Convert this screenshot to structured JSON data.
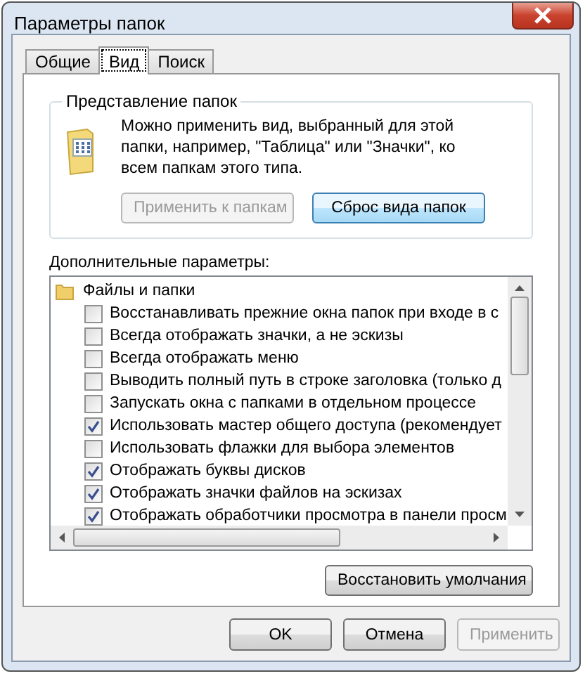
{
  "window": {
    "title": "Параметры папок"
  },
  "tabs": [
    {
      "label": "Общие",
      "selected": false
    },
    {
      "label": "Вид",
      "selected": true
    },
    {
      "label": "Поиск",
      "selected": false
    }
  ],
  "folder_views": {
    "title": "Представление папок",
    "description": "Можно применить вид, выбранный для этой папки, например, \"Таблица\" или \"Значки\", ко всем папкам этого типа.",
    "buttons": [
      {
        "label": "Применить к папкам",
        "disabled": true
      },
      {
        "label": "Сброс вида папок",
        "disabled": false
      }
    ]
  },
  "advanced": {
    "label": "Дополнительные параметры:",
    "tree": [
      {
        "kind": "folder",
        "label": "Файлы и папки",
        "children": [
          {
            "kind": "checkbox",
            "label": "Восстанавливать прежние окна папок при входе в с",
            "checked": false
          },
          {
            "kind": "checkbox",
            "label": "Всегда отображать значки, а не эскизы",
            "checked": false
          },
          {
            "kind": "checkbox",
            "label": "Всегда отображать меню",
            "checked": false
          },
          {
            "kind": "checkbox",
            "label": "Выводить полный путь в строке заголовка (только д",
            "checked": false
          },
          {
            "kind": "checkbox",
            "label": "Запускать окна с папками в отдельном процессе",
            "checked": false
          },
          {
            "kind": "checkbox",
            "label": "Использовать мастер общего доступа (рекомендует",
            "checked": true
          },
          {
            "kind": "checkbox",
            "label": "Использовать флажки для выбора элементов",
            "checked": false
          },
          {
            "kind": "checkbox",
            "label": "Отображать буквы дисков",
            "checked": true
          },
          {
            "kind": "checkbox",
            "label": "Отображать значки файлов на эскизах",
            "checked": true
          },
          {
            "kind": "checkbox",
            "label": "Отображать обработчики просмотра в панели просм",
            "checked": true
          }
        ]
      }
    ],
    "restore_button": {
      "label": "Восстановить умолчания",
      "disabled": false
    }
  },
  "buttons": [
    {
      "label": "OK",
      "disabled": false
    },
    {
      "label": "Отмена",
      "disabled": false
    },
    {
      "label": "Применить",
      "disabled": true
    }
  ]
}
